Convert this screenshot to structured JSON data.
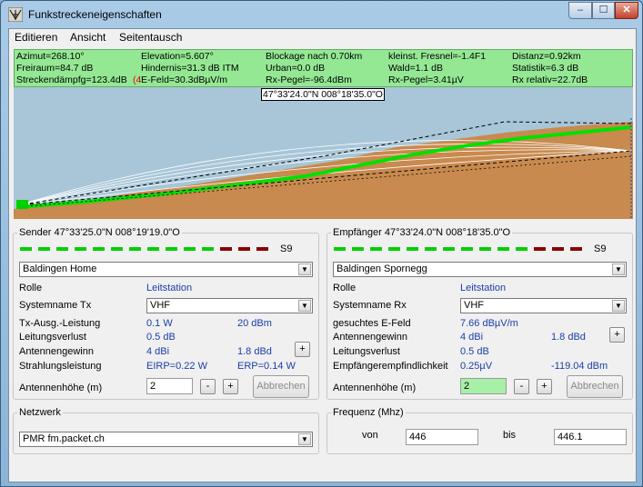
{
  "window": {
    "title": "Funkstreckeneigenschaften",
    "buttons": {
      "minimize": "–",
      "maximize": "☐",
      "close": "✕"
    }
  },
  "menu": [
    "Editieren",
    "Ansicht",
    "Seitentausch"
  ],
  "stats": {
    "row1": [
      "Azimut=268.10°",
      "Elevation=5.607°",
      "Blockage nach 0.70km",
      "kleinst. Fresnel=-1.4F1",
      "Distanz=0.92km"
    ],
    "row2": [
      "Freiraum=84.7 dB",
      "Hindernis=31.3 dB ITM",
      "Urban=0.0 dB",
      "Wald=1.1 dB",
      "Statistik=6.3 dB"
    ],
    "row3": [
      "Streckendämpfg=123.4dB",
      "(4",
      "E-Feld=30.3dBµV/m",
      "Rx-Pegel=-96.4dBm",
      "Rx-Pegel=3.41µV",
      "Rx relativ=22.7dB"
    ]
  },
  "profile": {
    "coord_label": "47°33'24.0\"N 008°18'35.0\"O"
  },
  "sender": {
    "legend": "Sender 47°33'25.0\"N 008°19'19.0\"O",
    "signal": "S9",
    "site": "Baldingen Home",
    "rolle_label": "Rolle",
    "rolle_value": "Leitstation",
    "system_label": "Systemname Tx",
    "system_value": "VHF",
    "power_label": "Tx-Ausg.-Leistung",
    "power_w": "0.1 W",
    "power_dbm": "20 dBm",
    "loss_label": "Leitungsverlust",
    "loss_value": "0.5 dB",
    "gain_label": "Antennengewinn",
    "gain_dbi": "4 dBi",
    "gain_dbd": "1.8 dBd",
    "radiated_label": "Strahlungsleistung",
    "eirp": "EIRP=0.22 W",
    "erp": "ERP=0.14 W",
    "height_label": "Antennenhöhe (m)",
    "height_value": "2",
    "cancel_label": "Abbrechen"
  },
  "receiver": {
    "legend": "Empfänger 47°33'24.0\"N 008°18'35.0\"O",
    "signal": "S9",
    "site": "Baldingen Spornegg",
    "rolle_label": "Rolle",
    "rolle_value": "Leitstation",
    "system_label": "Systemname Rx",
    "system_value": "VHF",
    "efield_label": "gesuchtes E-Feld",
    "efield_value": "7.66 dBµV/m",
    "gain_label": "Antennengewinn",
    "gain_dbi": "4 dBi",
    "gain_dbd": "1.8 dBd",
    "loss_label": "Leitungsverlust",
    "loss_value": "0.5 dB",
    "sens_label": "Empfängerempfindlichkeit",
    "sens_uv": "0.25µV",
    "sens_dbm": "-119.04 dBm",
    "height_label": "Antennenhöhe (m)",
    "height_value": "2",
    "cancel_label": "Abbrechen"
  },
  "network": {
    "legend": "Netzwerk",
    "value": "PMR fm.packet.ch"
  },
  "frequency": {
    "legend": "Frequenz (Mhz)",
    "from_label": "von",
    "from_value": "446",
    "to_label": "bis",
    "to_value": "446.1"
  },
  "colors": {
    "stats_bg": "#94e894",
    "terrain": "#c88a4e",
    "sky": "#a8c6d8",
    "path_green": "#00e000",
    "link_blue": "#1a3ea8",
    "meter_green": "#00d000",
    "meter_red": "#8b0000"
  }
}
